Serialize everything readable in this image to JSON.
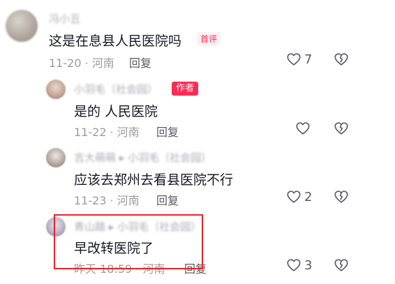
{
  "comments": [
    {
      "username": "冯小丑",
      "text": "这是在息县人民医院吗",
      "badge": "首评",
      "time_location": "11-20 · 河南",
      "reply_label": "回复",
      "likes": "7"
    },
    {
      "username": "小羽毛（社会园）",
      "author_badge": "作者",
      "text": "是的 人民医院",
      "time_location": "11-22 · 河南",
      "reply_label": "回复",
      "likes": ""
    },
    {
      "username": "吉大萌萌 ▸ 小羽毛（社会园）",
      "text": "应该去郑州去看县医院不行",
      "time_location": "11-23 · 河南",
      "reply_label": "回复",
      "likes": "2"
    },
    {
      "username": "青山踏 ▸ 小羽毛（社会园）",
      "text": "早改转医院了",
      "time_location": "昨天 18:59 · 河南",
      "reply_label": "回复",
      "likes": "3"
    }
  ],
  "icons": {
    "like": "heart-outline-icon",
    "dislike": "broken-heart-icon"
  },
  "colors": {
    "author_badge": "#fe2c55",
    "highlight_box": "#e8232a"
  }
}
